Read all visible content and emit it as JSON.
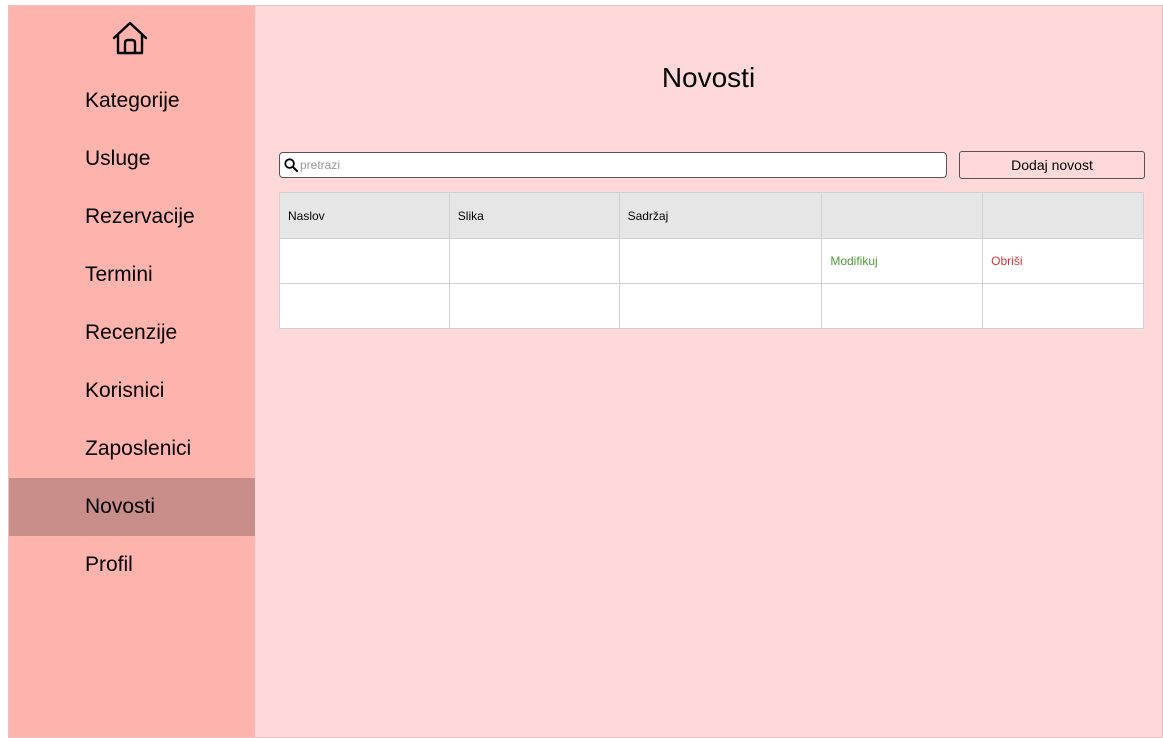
{
  "sidebar": {
    "home_icon": "home-icon",
    "items": [
      {
        "label": "Kategorije"
      },
      {
        "label": "Usluge"
      },
      {
        "label": "Rezervacije"
      },
      {
        "label": "Termini"
      },
      {
        "label": "Recenzije"
      },
      {
        "label": "Korisnici"
      },
      {
        "label": "Zaposlenici"
      },
      {
        "label": "Novosti",
        "active": true
      },
      {
        "label": "Profil"
      }
    ]
  },
  "main": {
    "title": "Novosti",
    "search": {
      "placeholder": "pretrazi",
      "value": "",
      "icon": "search-icon"
    },
    "add_button": "Dodaj novost",
    "table": {
      "headers": [
        "Naslov",
        "Slika",
        "Sadržaj",
        "",
        ""
      ],
      "rows": [
        {
          "naslov": "",
          "slika": "",
          "sadrzaj": "",
          "edit": "Modifikuj",
          "delete": "Obriši"
        },
        {
          "naslov": "",
          "slika": "",
          "sadrzaj": "",
          "edit": "",
          "delete": ""
        }
      ]
    }
  },
  "colors": {
    "background": "#ffd9d9",
    "sidebar": "#ffb3ad",
    "sidebar_active": "#c98d8a",
    "edit_link": "#4a9a3a",
    "delete_link": "#e03030"
  }
}
